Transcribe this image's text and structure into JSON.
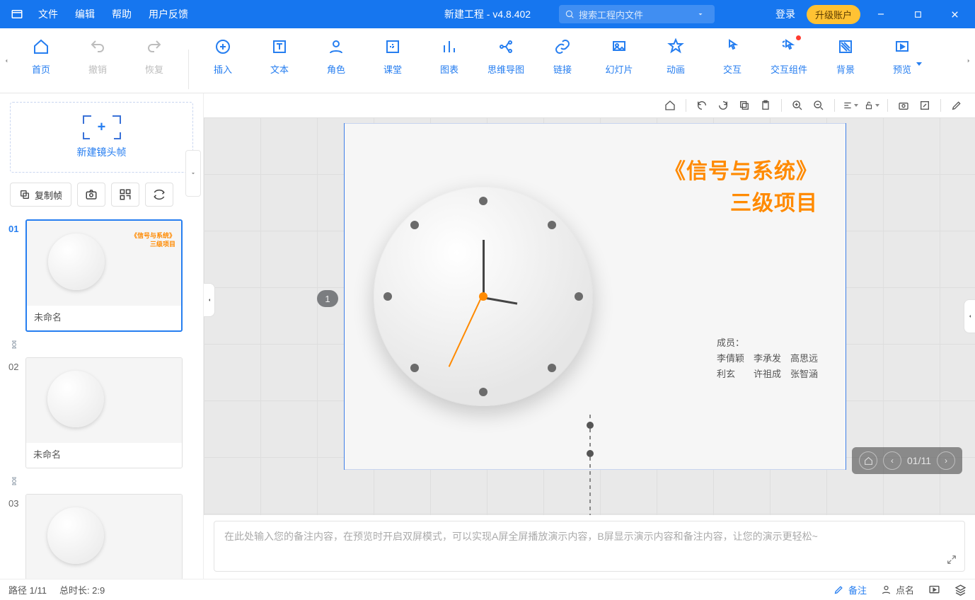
{
  "app": {
    "title": "新建工程 - v4.8.402",
    "menu": [
      "文件",
      "编辑",
      "帮助",
      "用户反馈"
    ],
    "search_placeholder": "搜索工程内文件",
    "login": "登录",
    "upgrade": "升级账户"
  },
  "ribbon": {
    "items": [
      {
        "label": "首页",
        "icon": "home",
        "enabled": true
      },
      {
        "label": "撤销",
        "icon": "undo",
        "enabled": false
      },
      {
        "label": "恢复",
        "icon": "redo",
        "enabled": false
      },
      {
        "__divider": true
      },
      {
        "label": "插入",
        "icon": "plus",
        "enabled": true
      },
      {
        "label": "文本",
        "icon": "text",
        "enabled": true
      },
      {
        "label": "角色",
        "icon": "person",
        "enabled": true
      },
      {
        "label": "课堂",
        "icon": "class",
        "enabled": true
      },
      {
        "label": "图表",
        "icon": "chart",
        "enabled": true
      },
      {
        "label": "思维导图",
        "icon": "mindmap",
        "enabled": true
      },
      {
        "label": "链接",
        "icon": "link",
        "enabled": true
      },
      {
        "label": "幻灯片",
        "icon": "slides",
        "enabled": true
      },
      {
        "label": "动画",
        "icon": "anim",
        "enabled": true
      },
      {
        "label": "交互",
        "icon": "interact",
        "enabled": true
      },
      {
        "label": "交互组件",
        "icon": "widget",
        "enabled": true,
        "notif": true
      },
      {
        "label": "背景",
        "icon": "bg",
        "enabled": true
      },
      {
        "label": "预览",
        "icon": "preview",
        "enabled": true,
        "dropdown": true
      }
    ]
  },
  "slides": {
    "new_frame_label": "新建镜头帧",
    "copy_label": "复制帧",
    "items": [
      {
        "num": "01",
        "title": "未命名",
        "active": true,
        "mini_title": "《信号与系统》\n三级项目"
      },
      {
        "num": "02",
        "title": "未命名",
        "active": false,
        "mini_title": ""
      },
      {
        "num": "03",
        "title": "",
        "active": false,
        "mini_title": ""
      }
    ]
  },
  "canvas": {
    "step_badge": "1",
    "title_line1": "《信号与系统》",
    "title_line2": "三级项目",
    "members_label": "成员：",
    "members_line1": "李倩颖　李承发　高思远",
    "members_line2": "利玄　　许祖成　张智涵",
    "page_indicator": "01/11"
  },
  "notes": {
    "placeholder": "在此处输入您的备注内容，在预览时开启双屏模式，可以实现A屏全屏播放演示内容，B屏显示演示内容和备注内容，让您的演示更轻松~"
  },
  "status": {
    "path": "路径 1/11",
    "duration": "总时长: 2:9",
    "remark": "备注",
    "roll": "点名"
  }
}
